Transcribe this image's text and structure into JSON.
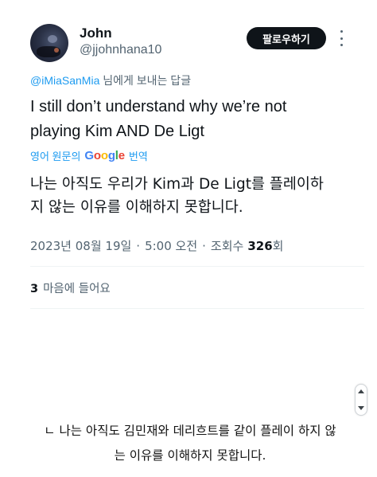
{
  "tweet": {
    "author_name": "John",
    "author_handle": "@jjohnhana10",
    "follow_label": "팔로우하기",
    "reply_to_mention": "@iMiaSanMia",
    "reply_to_suffix": " 님에게 보내는 답글",
    "text_line1": "I still don’t understand why we’re not",
    "text_line2": "playing Kim AND De Ligt",
    "translate_prefix": "영어 원문의",
    "translate_brand": "Google",
    "translate_suffix": "번역",
    "translated_line1": "나는 아직도 우리가 Kim과 De Ligt를 플레이하",
    "translated_line2": "지 않는 이유를 이해하지 못합니다.",
    "date": "2023년 08월 19일",
    "time": "5:00 오전",
    "views_label": "조회수",
    "views_count": "326",
    "views_unit": "회",
    "likes_count": "3",
    "likes_label": "마음에 들어요"
  },
  "caption": {
    "line1": "ㄴ 나는 아직도 김민재와 데리흐트를 같이 플레이 하지 않",
    "line2": "는 이유를 이해하지 못합니다."
  },
  "colors": {
    "accent": "#1d9bf0",
    "text_primary": "#0f1419",
    "text_secondary": "#536471",
    "button_bg": "#0f1419"
  },
  "icons": {
    "more": "more-vertical-icon",
    "scroll": "scroll-arrows-icon"
  }
}
